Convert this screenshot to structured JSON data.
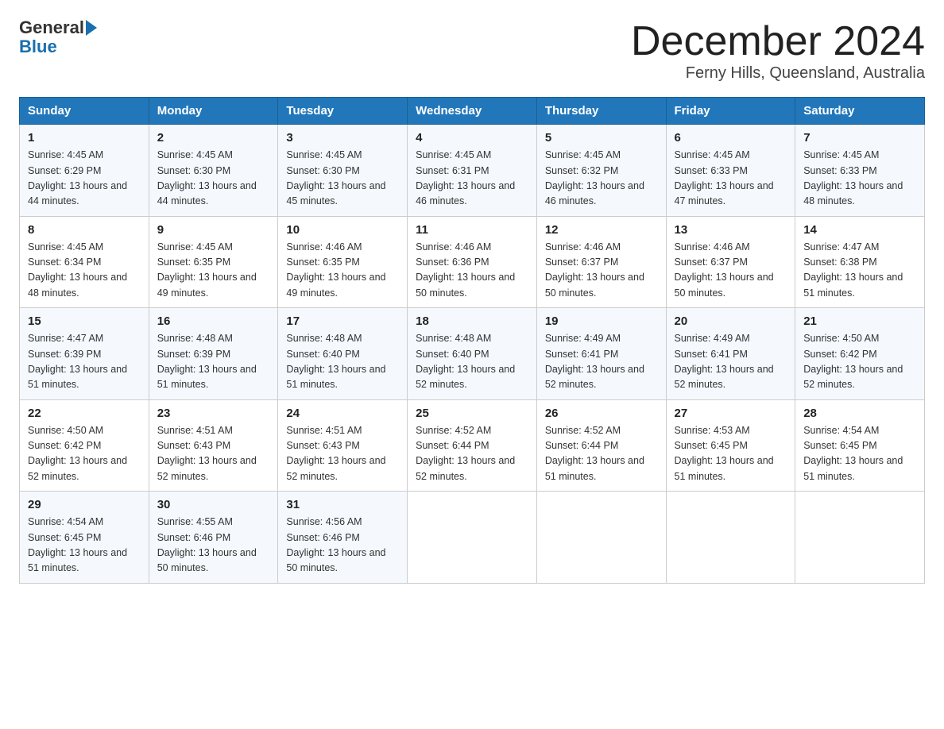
{
  "logo": {
    "general": "General",
    "triangle": "▶",
    "blue": "Blue"
  },
  "title": "December 2024",
  "location": "Ferny Hills, Queensland, Australia",
  "days_of_week": [
    "Sunday",
    "Monday",
    "Tuesday",
    "Wednesday",
    "Thursday",
    "Friday",
    "Saturday"
  ],
  "weeks": [
    [
      {
        "day": "1",
        "sunrise": "4:45 AM",
        "sunset": "6:29 PM",
        "daylight": "13 hours and 44 minutes."
      },
      {
        "day": "2",
        "sunrise": "4:45 AM",
        "sunset": "6:30 PM",
        "daylight": "13 hours and 44 minutes."
      },
      {
        "day": "3",
        "sunrise": "4:45 AM",
        "sunset": "6:30 PM",
        "daylight": "13 hours and 45 minutes."
      },
      {
        "day": "4",
        "sunrise": "4:45 AM",
        "sunset": "6:31 PM",
        "daylight": "13 hours and 46 minutes."
      },
      {
        "day": "5",
        "sunrise": "4:45 AM",
        "sunset": "6:32 PM",
        "daylight": "13 hours and 46 minutes."
      },
      {
        "day": "6",
        "sunrise": "4:45 AM",
        "sunset": "6:33 PM",
        "daylight": "13 hours and 47 minutes."
      },
      {
        "day": "7",
        "sunrise": "4:45 AM",
        "sunset": "6:33 PM",
        "daylight": "13 hours and 48 minutes."
      }
    ],
    [
      {
        "day": "8",
        "sunrise": "4:45 AM",
        "sunset": "6:34 PM",
        "daylight": "13 hours and 48 minutes."
      },
      {
        "day": "9",
        "sunrise": "4:45 AM",
        "sunset": "6:35 PM",
        "daylight": "13 hours and 49 minutes."
      },
      {
        "day": "10",
        "sunrise": "4:46 AM",
        "sunset": "6:35 PM",
        "daylight": "13 hours and 49 minutes."
      },
      {
        "day": "11",
        "sunrise": "4:46 AM",
        "sunset": "6:36 PM",
        "daylight": "13 hours and 50 minutes."
      },
      {
        "day": "12",
        "sunrise": "4:46 AM",
        "sunset": "6:37 PM",
        "daylight": "13 hours and 50 minutes."
      },
      {
        "day": "13",
        "sunrise": "4:46 AM",
        "sunset": "6:37 PM",
        "daylight": "13 hours and 50 minutes."
      },
      {
        "day": "14",
        "sunrise": "4:47 AM",
        "sunset": "6:38 PM",
        "daylight": "13 hours and 51 minutes."
      }
    ],
    [
      {
        "day": "15",
        "sunrise": "4:47 AM",
        "sunset": "6:39 PM",
        "daylight": "13 hours and 51 minutes."
      },
      {
        "day": "16",
        "sunrise": "4:48 AM",
        "sunset": "6:39 PM",
        "daylight": "13 hours and 51 minutes."
      },
      {
        "day": "17",
        "sunrise": "4:48 AM",
        "sunset": "6:40 PM",
        "daylight": "13 hours and 51 minutes."
      },
      {
        "day": "18",
        "sunrise": "4:48 AM",
        "sunset": "6:40 PM",
        "daylight": "13 hours and 52 minutes."
      },
      {
        "day": "19",
        "sunrise": "4:49 AM",
        "sunset": "6:41 PM",
        "daylight": "13 hours and 52 minutes."
      },
      {
        "day": "20",
        "sunrise": "4:49 AM",
        "sunset": "6:41 PM",
        "daylight": "13 hours and 52 minutes."
      },
      {
        "day": "21",
        "sunrise": "4:50 AM",
        "sunset": "6:42 PM",
        "daylight": "13 hours and 52 minutes."
      }
    ],
    [
      {
        "day": "22",
        "sunrise": "4:50 AM",
        "sunset": "6:42 PM",
        "daylight": "13 hours and 52 minutes."
      },
      {
        "day": "23",
        "sunrise": "4:51 AM",
        "sunset": "6:43 PM",
        "daylight": "13 hours and 52 minutes."
      },
      {
        "day": "24",
        "sunrise": "4:51 AM",
        "sunset": "6:43 PM",
        "daylight": "13 hours and 52 minutes."
      },
      {
        "day": "25",
        "sunrise": "4:52 AM",
        "sunset": "6:44 PM",
        "daylight": "13 hours and 52 minutes."
      },
      {
        "day": "26",
        "sunrise": "4:52 AM",
        "sunset": "6:44 PM",
        "daylight": "13 hours and 51 minutes."
      },
      {
        "day": "27",
        "sunrise": "4:53 AM",
        "sunset": "6:45 PM",
        "daylight": "13 hours and 51 minutes."
      },
      {
        "day": "28",
        "sunrise": "4:54 AM",
        "sunset": "6:45 PM",
        "daylight": "13 hours and 51 minutes."
      }
    ],
    [
      {
        "day": "29",
        "sunrise": "4:54 AM",
        "sunset": "6:45 PM",
        "daylight": "13 hours and 51 minutes."
      },
      {
        "day": "30",
        "sunrise": "4:55 AM",
        "sunset": "6:46 PM",
        "daylight": "13 hours and 50 minutes."
      },
      {
        "day": "31",
        "sunrise": "4:56 AM",
        "sunset": "6:46 PM",
        "daylight": "13 hours and 50 minutes."
      },
      null,
      null,
      null,
      null
    ]
  ]
}
